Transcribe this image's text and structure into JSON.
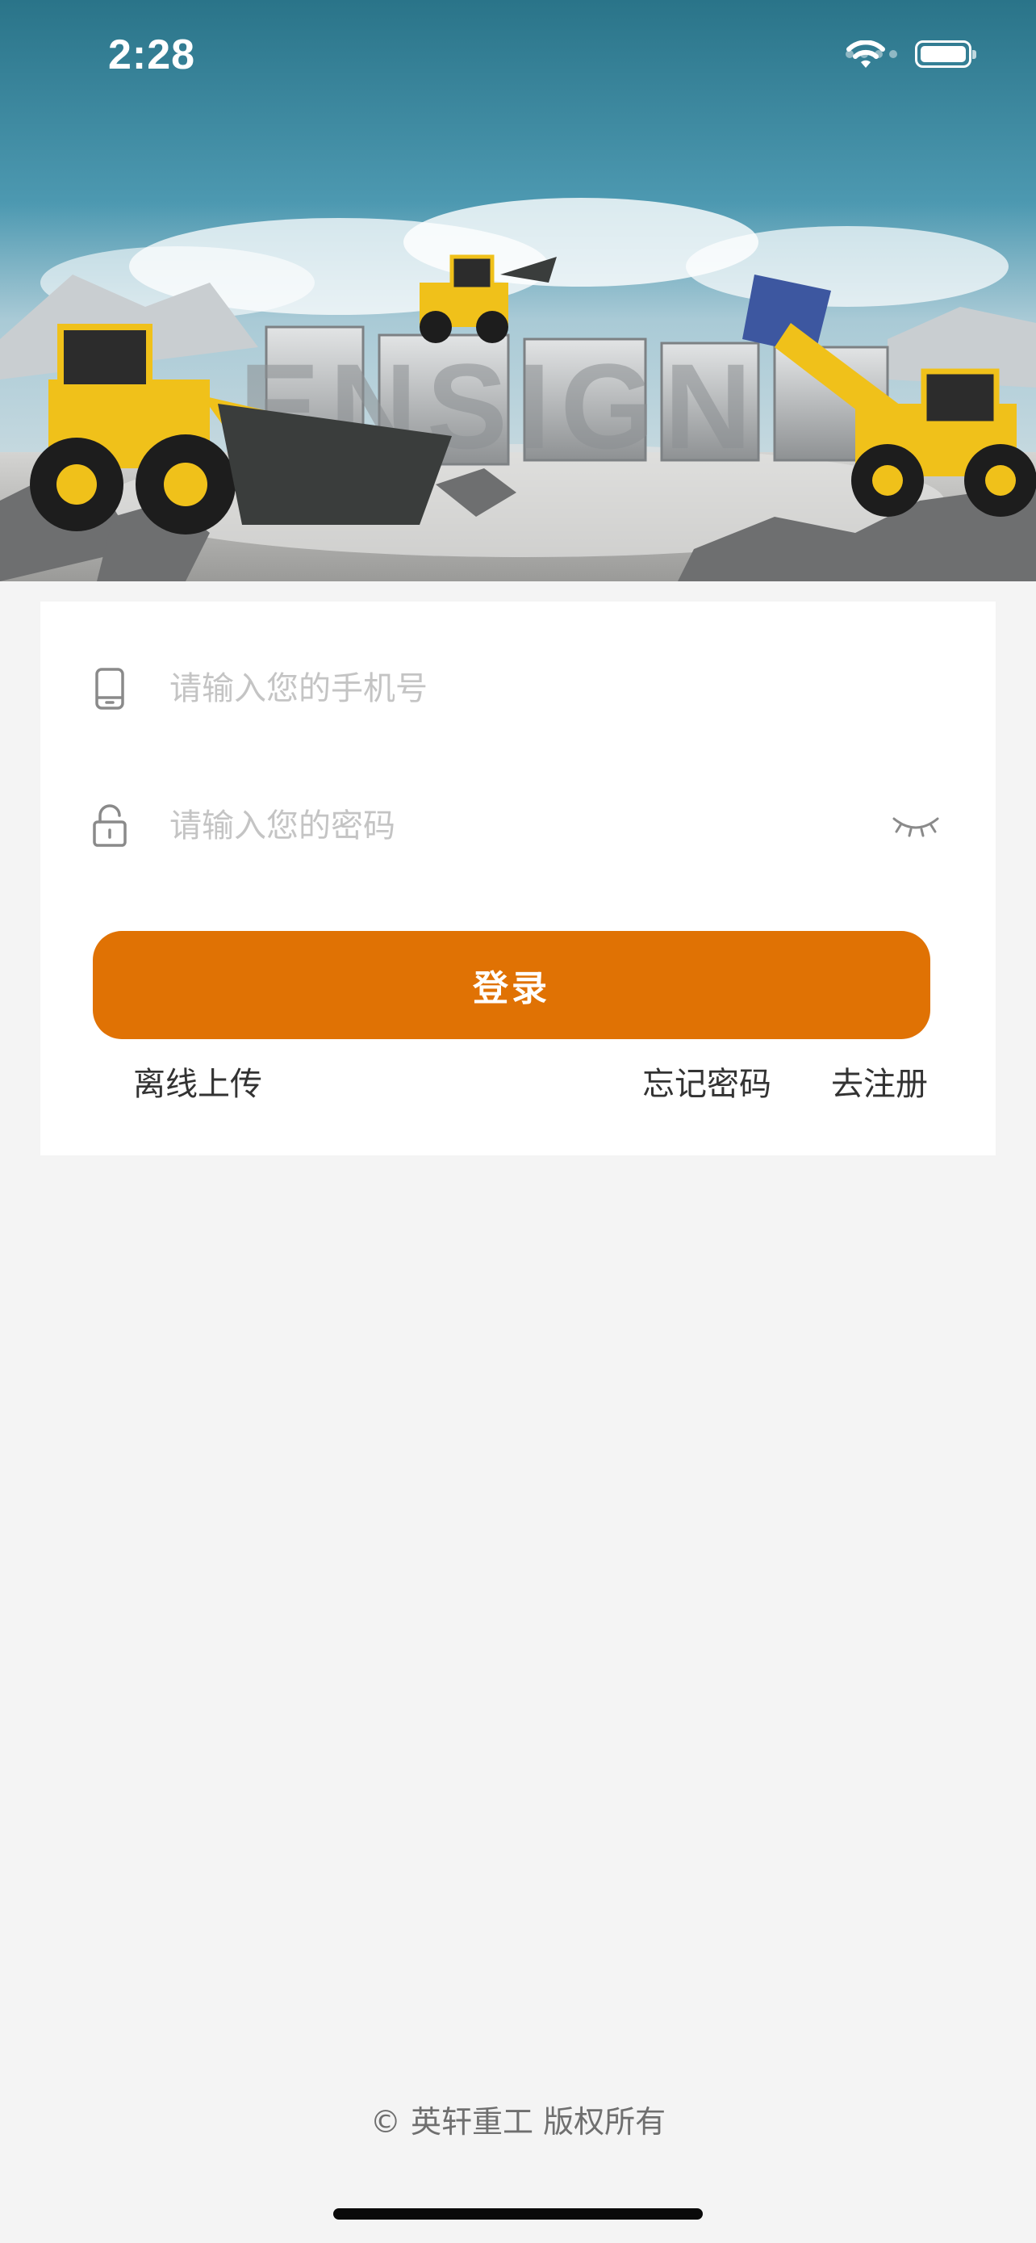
{
  "status_bar": {
    "time": "2:28",
    "icons": [
      "signal-icon",
      "wifi-icon",
      "battery-icon"
    ]
  },
  "hero": {
    "brand_text": "ENSIGN",
    "description_icon": "wheel-loader-banner-image"
  },
  "login_form": {
    "phone_placeholder": "请输入您的手机号",
    "phone_value": "",
    "password_placeholder": "请输入您的密码",
    "password_value": "",
    "phone_icon": "phone-icon",
    "lock_icon": "lock-icon",
    "eye_icon": "eye-closed-icon",
    "login_label": "登录",
    "offline_upload_label": "离线上传",
    "forgot_password_label": "忘记密码",
    "register_label": "去注册"
  },
  "footer": {
    "copyright": "© 英轩重工  版权所有"
  },
  "colors": {
    "accent": "#e07204",
    "background": "#f4f4f4",
    "card": "#ffffff",
    "placeholder": "#c4c4c4",
    "text": "#333333"
  }
}
